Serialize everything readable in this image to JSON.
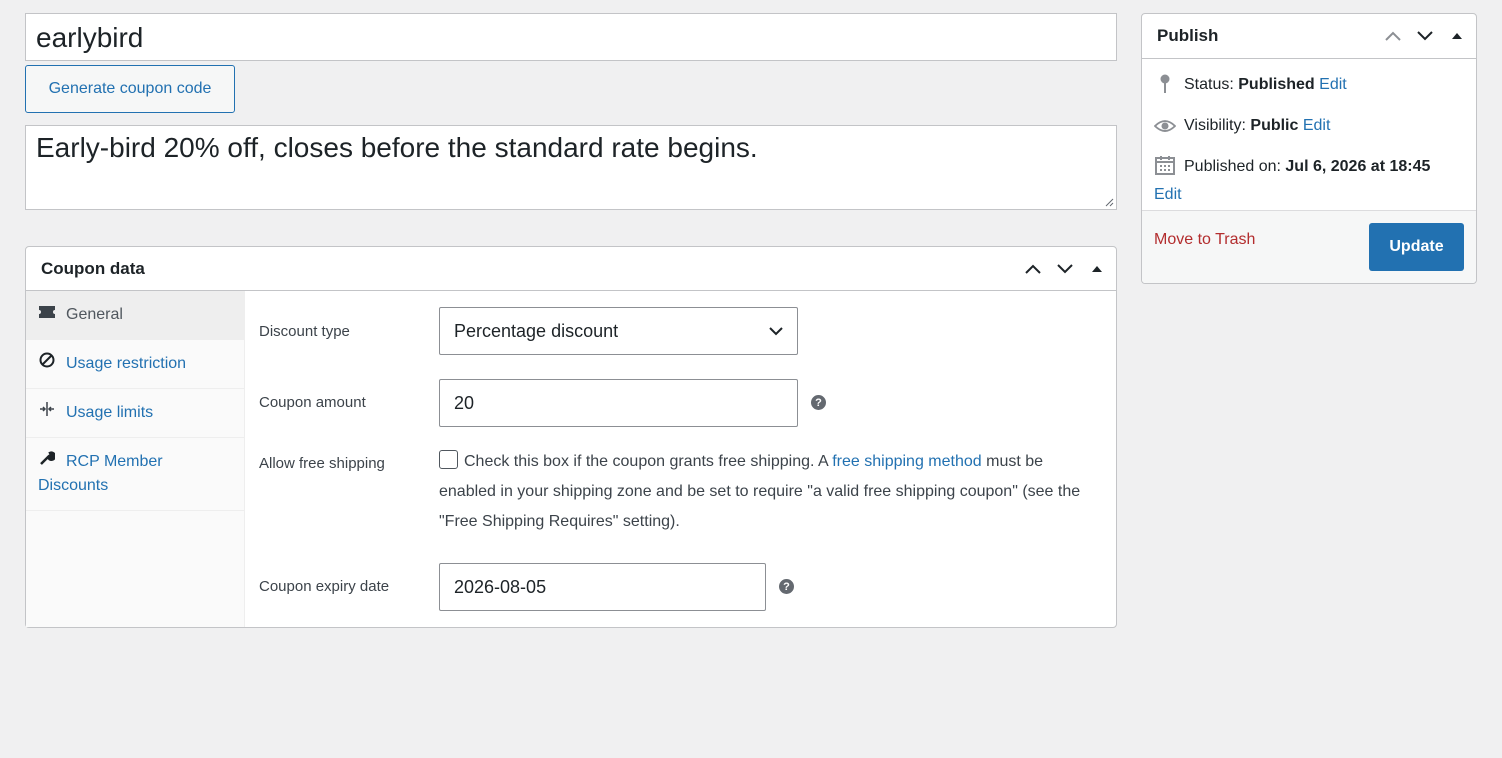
{
  "coupon": {
    "code": "earlybird",
    "generate_label": "Generate coupon code",
    "description": "Early-bird 20% off, closes before the standard rate begins."
  },
  "coupon_data": {
    "title": "Coupon data",
    "tabs": [
      {
        "label": "General",
        "icon": "ticket-icon"
      },
      {
        "label": "Usage restriction",
        "icon": "no-entry-icon"
      },
      {
        "label": "Usage limits",
        "icon": "arrows-icon"
      },
      {
        "label": "RCP Member Discounts",
        "icon": "wrench-icon"
      }
    ],
    "fields": {
      "discount_type_label": "Discount type",
      "discount_type_value": "Percentage discount",
      "amount_label": "Coupon amount",
      "amount_value": "20",
      "free_shipping_label": "Allow free shipping",
      "free_shipping_text_1": "Check this box if the coupon grants free shipping. A ",
      "free_shipping_link": "free shipping method",
      "free_shipping_text_2": " must be enabled in your shipping zone and be set to require \"a valid free shipping coupon\" (see the \"Free Shipping Requires\" setting).",
      "expiry_label": "Coupon expiry date",
      "expiry_value": "2026-08-05",
      "help_glyph": "?"
    }
  },
  "publish": {
    "title": "Publish",
    "status_label": "Status: ",
    "status_value": "Published",
    "visibility_label": "Visibility: ",
    "visibility_value": "Public",
    "published_label": "Published on: ",
    "published_value": "Jul 6, 2026 at 18:45",
    "edit_label": "Edit",
    "trash_label": "Move to Trash",
    "update_label": "Update"
  },
  "colors": {
    "accent": "#2271b1",
    "danger": "#b32d2e"
  }
}
